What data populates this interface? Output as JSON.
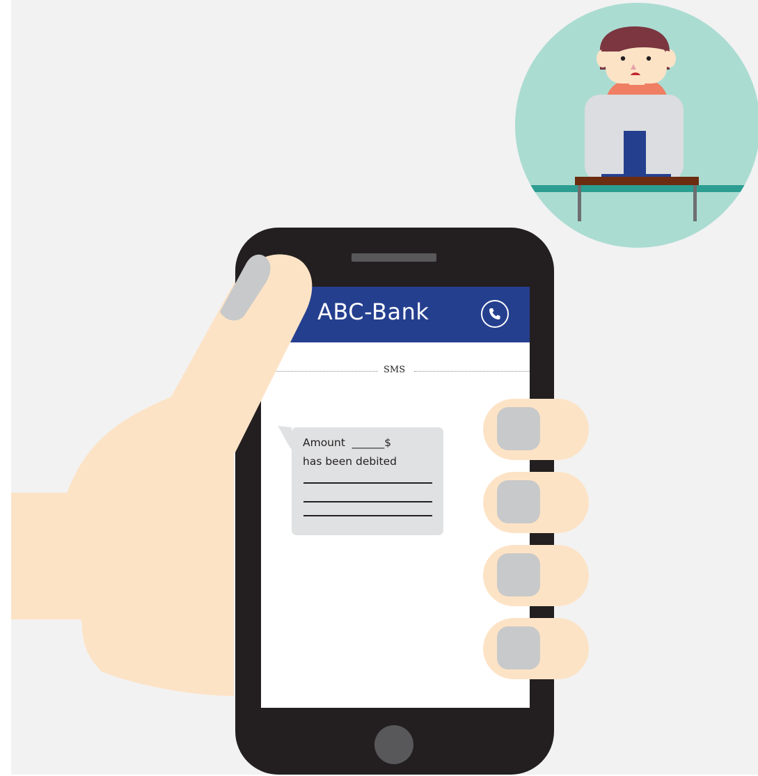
{
  "app_bar": {
    "title": "ABC-Bank",
    "call_icon": "phone-call-icon"
  },
  "thread": {
    "divider_label": "SMS"
  },
  "message": {
    "line1": "Amount  ______$",
    "line2": "has been debited",
    "redacted_lines": 3
  },
  "illustration": {
    "scene": "hand-holding-phone",
    "inset": "worried-person-at-computer"
  },
  "colors": {
    "app_bar": "#253f8f",
    "phone_body": "#231f20",
    "skin": "#fde3c6",
    "nail": "#c8c9ca",
    "bubble": "#e0e1e2",
    "inset_bg": "#abdcd2",
    "background": "#f2f2f2"
  }
}
